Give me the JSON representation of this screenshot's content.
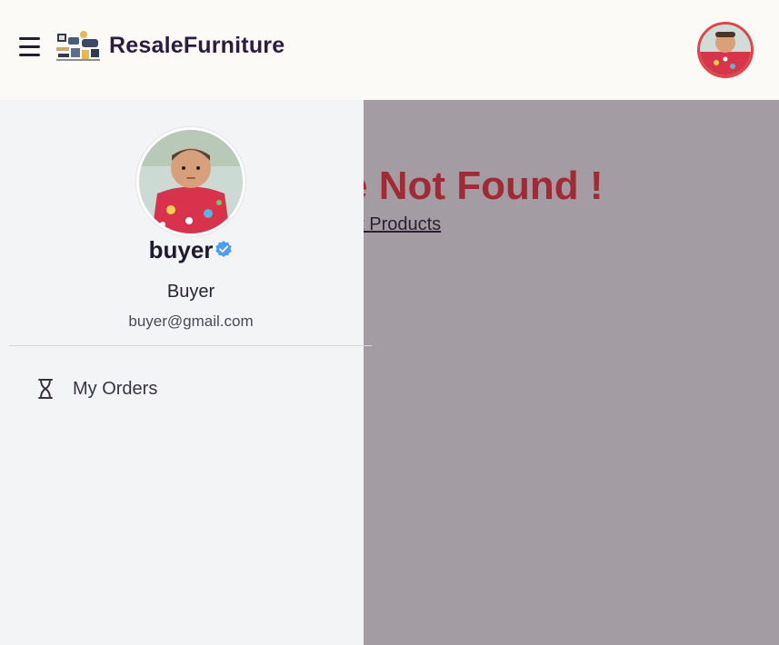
{
  "header": {
    "brand": "ResaleFurniture"
  },
  "main": {
    "heading": "e Not Found !",
    "link_text": "et Products"
  },
  "drawer": {
    "user_name": "buyer",
    "role": "Buyer",
    "email": "buyer@gmail.com",
    "menu": [
      {
        "label": "My Orders",
        "icon": "hourglass-icon"
      }
    ]
  },
  "colors": {
    "accent_red": "#a12a36",
    "avatar_border": "#e0454a",
    "verified_blue": "#4a9ff5",
    "overlay": "#a39da3"
  }
}
